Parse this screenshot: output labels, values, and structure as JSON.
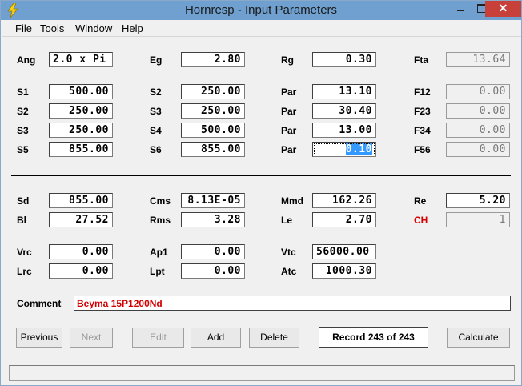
{
  "window": {
    "title": "Hornresp - Input Parameters",
    "close_glyph": "✕"
  },
  "menu": {
    "file": "File",
    "tools": "Tools",
    "window": "Window",
    "help": "Help"
  },
  "fields": {
    "ang": {
      "label": "Ang",
      "value": "2.0 x Pi"
    },
    "eg": {
      "label": "Eg",
      "value": "2.80"
    },
    "rg": {
      "label": "Rg",
      "value": "0.30"
    },
    "fta": {
      "label": "Fta",
      "value": "13.64"
    },
    "s1": {
      "label": "S1",
      "value": "500.00"
    },
    "s2": {
      "label": "S2",
      "value": "250.00"
    },
    "par1": {
      "label": "Par",
      "value": "13.10"
    },
    "f12": {
      "label": "F12",
      "value": "0.00"
    },
    "s2b": {
      "label": "S2",
      "value": "250.00"
    },
    "s3": {
      "label": "S3",
      "value": "250.00"
    },
    "par2": {
      "label": "Par",
      "value": "30.40"
    },
    "f23": {
      "label": "F23",
      "value": "0.00"
    },
    "s3b": {
      "label": "S3",
      "value": "250.00"
    },
    "s4": {
      "label": "S4",
      "value": "500.00"
    },
    "par3": {
      "label": "Par",
      "value": "13.00"
    },
    "f34": {
      "label": "F34",
      "value": "0.00"
    },
    "s5": {
      "label": "S5",
      "value": "855.00"
    },
    "s6": {
      "label": "S6",
      "value": "855.00"
    },
    "par4": {
      "label": "Par",
      "value": "0.10"
    },
    "f56": {
      "label": "F56",
      "value": "0.00"
    },
    "sd": {
      "label": "Sd",
      "value": "855.00"
    },
    "cms": {
      "label": "Cms",
      "value": "8.13E-05"
    },
    "mmd": {
      "label": "Mmd",
      "value": "162.26"
    },
    "re": {
      "label": "Re",
      "value": "5.20"
    },
    "bl": {
      "label": "Bl",
      "value": "27.52"
    },
    "rms": {
      "label": "Rms",
      "value": "3.28"
    },
    "le": {
      "label": "Le",
      "value": "2.70"
    },
    "ch": {
      "label": "CH",
      "value": "1"
    },
    "vrc": {
      "label": "Vrc",
      "value": "0.00"
    },
    "ap1": {
      "label": "Ap1",
      "value": "0.00"
    },
    "vtc": {
      "label": "Vtc",
      "value": "56000.00"
    },
    "lrc": {
      "label": "Lrc",
      "value": "0.00"
    },
    "lpt": {
      "label": "Lpt",
      "value": "0.00"
    },
    "atc": {
      "label": "Atc",
      "value": "1000.30"
    }
  },
  "comment": {
    "label": "Comment",
    "value": "Beyma 15P1200Nd"
  },
  "buttons": {
    "previous": "Previous",
    "next": "Next",
    "edit": "Edit",
    "add": "Add",
    "delete": "Delete",
    "calculate": "Calculate"
  },
  "record": "Record 243 of 243",
  "colors": {
    "titlebar": "#6fa0cf",
    "close_button": "#c7413a",
    "accent_red": "#d40000",
    "selection": "#3399ff"
  },
  "icons": {
    "app": "lightning-bolt-icon"
  }
}
